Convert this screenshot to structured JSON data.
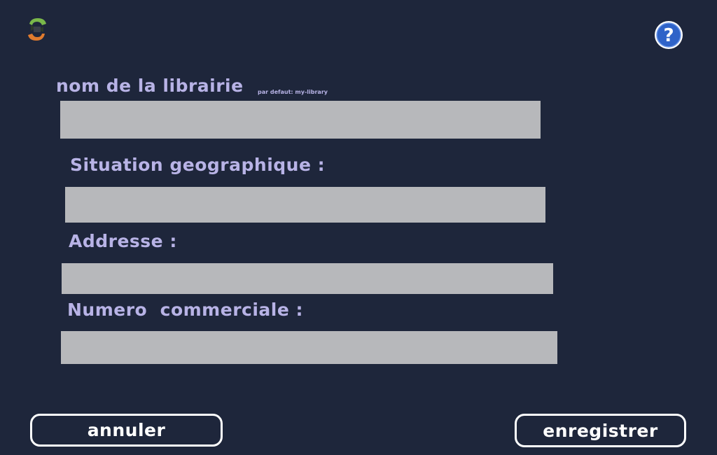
{
  "icons": {
    "app_logo": "refresh-logo-icon",
    "help": "help-question-icon"
  },
  "colors": {
    "background": "#1e263b",
    "label": "#b8b3e6",
    "field": "#b7b8bb",
    "button_border": "#ffffff"
  },
  "form": {
    "library_name": {
      "label": "nom de la librairie",
      "hint": "par defaut: my-library",
      "value": ""
    },
    "location": {
      "label": "Situation geographique :",
      "value": ""
    },
    "address": {
      "label": "Addresse :",
      "value": ""
    },
    "commercial_number": {
      "label": "Numero  commerciale :",
      "value": ""
    }
  },
  "buttons": {
    "cancel": "annuler",
    "save": "enregistrer"
  }
}
